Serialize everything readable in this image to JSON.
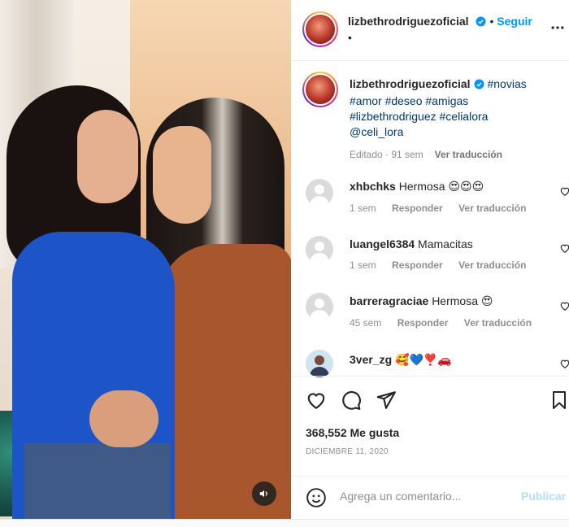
{
  "post": {
    "username": "lizbethrodriguezoficial",
    "follow_label": "Seguir",
    "more_dot": "•",
    "caption": {
      "username": "lizbethrodriguezoficial",
      "tags_line1": "#novias",
      "tags_line2": "#amor #deseo #amigas",
      "tags_line3": "#lizbethrodriguez #celialora",
      "mention": "@celi_lora",
      "edited": "Editado · 91 sem",
      "translate": "Ver traducción"
    },
    "comments": [
      {
        "user": "xhbchks",
        "text": "Hermosa",
        "emoji": "😍😍😍",
        "time": "1 sem",
        "reply": "Responder",
        "translate": "Ver traducción"
      },
      {
        "user": "luangel6384",
        "text": "Mamacitas",
        "emoji": "",
        "time": "1 sem",
        "reply": "Responder",
        "translate": "Ver traducción"
      },
      {
        "user": "barreragraciae",
        "text": "Hermosa",
        "emoji": "😍",
        "time": "45 sem",
        "reply": "Responder",
        "translate": "Ver traducción"
      },
      {
        "user": "3ver_zg",
        "text": "",
        "emoji": "🥰💙❣️🚗",
        "time": "",
        "reply": "",
        "translate": ""
      }
    ],
    "likes": "368,552 Me gusta",
    "date": "DICIEMBRE 11, 2020",
    "comment_placeholder": "Agrega un comentario...",
    "post_label": "Publicar"
  },
  "colors": {
    "accent": "#0095f6",
    "hashtag": "#00376b",
    "muted": "#8e8e8e",
    "publish_disabled": "#b2dffc",
    "heart_emoji": "#e0245e"
  }
}
